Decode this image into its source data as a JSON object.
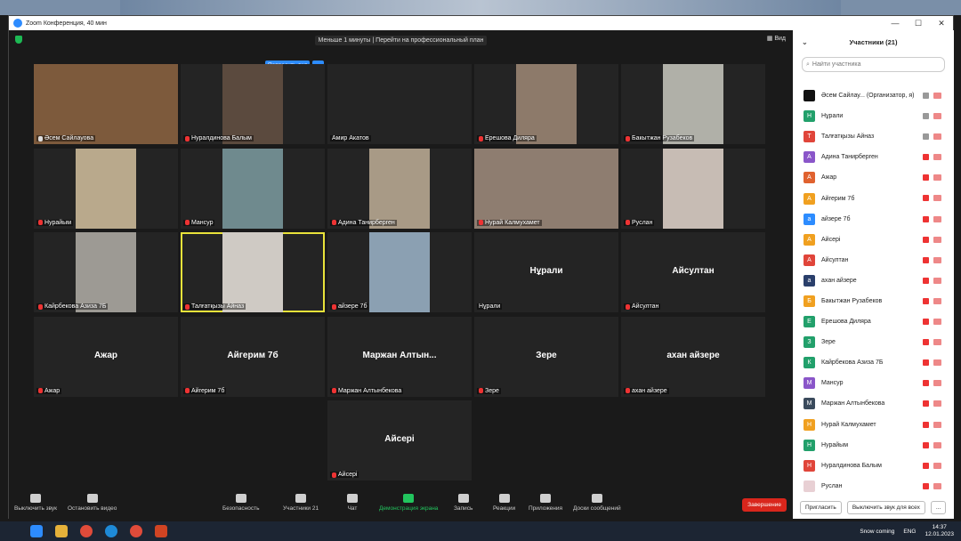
{
  "window": {
    "title": "Zoom Конференция, 40 мин",
    "controls": [
      "—",
      "☐",
      "✕"
    ]
  },
  "banner": "Меньше 1 минуты | Перейти на профессиональный план",
  "view_label": "▦ Вид",
  "ask_button": "Попросить вкл",
  "ask_more": "···",
  "tiles": [
    {
      "name": "Әсем Сайлауова",
      "mic": "on",
      "video": "#7d5a3c"
    },
    {
      "name": "Нуралдинова Балым",
      "mic": "off",
      "video": "#5b4a3e"
    },
    {
      "name": "Амир Акатов",
      "mic": "none",
      "video": ""
    },
    {
      "name": "Ерешова Диляра",
      "mic": "off",
      "video": "#8d7a6a"
    },
    {
      "name": "Бакытжан Рузабеков",
      "mic": "off",
      "video": "#b0b0a8"
    },
    {
      "name": "Нурайым",
      "mic": "off",
      "video": "#b9a98c"
    },
    {
      "name": "Мансур",
      "mic": "off",
      "video": "#6f8a8e"
    },
    {
      "name": "Адина Танирберген",
      "mic": "off",
      "video": "#a89a86"
    },
    {
      "name": "Нурай Калмухамет",
      "mic": "off",
      "video": "#8e7d70"
    },
    {
      "name": "Руслан",
      "mic": "off",
      "video": "#c7bcb4"
    },
    {
      "name": "Кайрбекова Азиза 7Б",
      "mic": "off",
      "video": "#9d9a94"
    },
    {
      "name": "Талғатқызы Айназ",
      "mic": "off",
      "video": "#cfcac4"
    },
    {
      "name": "айзере 7б",
      "mic": "off",
      "video": "#8ba0b2"
    },
    {
      "name": "Нұрали",
      "mic": "none",
      "big": "Нұрали"
    },
    {
      "name": "Айсултан",
      "mic": "off",
      "big": "Айсултан"
    },
    {
      "name": "Ажар",
      "mic": "off",
      "big": "Ажар"
    },
    {
      "name": "Айгерим 7б",
      "mic": "off",
      "big": "Айгерим 7б"
    },
    {
      "name": "Маржан Алтынбекова",
      "mic": "off",
      "big": "Маржан  Алтын..."
    },
    {
      "name": "Зере",
      "mic": "off",
      "big": "Зере"
    },
    {
      "name": "ахан айзере",
      "mic": "off",
      "big": "ахан айзере"
    },
    {
      "name": "Айсері",
      "mic": "off",
      "big": "Айсері"
    }
  ],
  "toolbar": {
    "audio": "Выключить звук",
    "video": "Остановить видео",
    "security": "Безопасность",
    "participants": "Участники",
    "participants_count": "21",
    "chat": "Чат",
    "share": "Демонстрация экрана",
    "record": "Запись",
    "reactions": "Реакции",
    "apps": "Приложения",
    "whiteboards": "Доски сообщений",
    "end": "Завершение"
  },
  "panel": {
    "title": "Участники (21)",
    "search_placeholder": "Найти участника",
    "invite": "Пригласить",
    "mute_all": "Выключить звук для всех",
    "more": "...",
    "participants": [
      {
        "initial": "",
        "name": "Әсем Сайлау... (Организатор, я)",
        "color": "#111111",
        "muted": false
      },
      {
        "initial": "Н",
        "name": "Нұрали",
        "color": "#22a06b",
        "muted": false
      },
      {
        "initial": "Т",
        "name": "Талғатқызы Айназ",
        "color": "#e0453a",
        "muted": false
      },
      {
        "initial": "А",
        "name": "Адина Танирберген",
        "color": "#8a56c9",
        "muted": true
      },
      {
        "initial": "А",
        "name": "Ажар",
        "color": "#e0622f",
        "muted": true
      },
      {
        "initial": "А",
        "name": "Айгерим 7б",
        "color": "#f0a020",
        "muted": true
      },
      {
        "initial": "а",
        "name": "айзере 7б",
        "color": "#2d8cff",
        "muted": true
      },
      {
        "initial": "А",
        "name": "Айсері",
        "color": "#f0a020",
        "muted": true
      },
      {
        "initial": "А",
        "name": "Айсултан",
        "color": "#e0453a",
        "muted": true
      },
      {
        "initial": "а",
        "name": "ахан айзере",
        "color": "#2a3f6b",
        "muted": true
      },
      {
        "initial": "Б",
        "name": "Бакытжан Рузабеков",
        "color": "#f0a020",
        "muted": true
      },
      {
        "initial": "Е",
        "name": "Ерешова Диляра",
        "color": "#22a06b",
        "muted": true
      },
      {
        "initial": "З",
        "name": "Зере",
        "color": "#22a06b",
        "muted": true
      },
      {
        "initial": "К",
        "name": "Кайрбекова Азиза 7Б",
        "color": "#22a06b",
        "muted": true
      },
      {
        "initial": "М",
        "name": "Мансур",
        "color": "#8a56c9",
        "muted": true
      },
      {
        "initial": "М",
        "name": "Маржан Алтынбекова",
        "color": "#3a4a5c",
        "muted": true
      },
      {
        "initial": "Н",
        "name": "Нурай Калмухамет",
        "color": "#f0a020",
        "muted": true
      },
      {
        "initial": "Н",
        "name": "Нурайым",
        "color": "#22a06b",
        "muted": true
      },
      {
        "initial": "Н",
        "name": "Нуралдинова Балым",
        "color": "#e0453a",
        "muted": true
      },
      {
        "initial": "",
        "name": "Руслан",
        "color": "#e8d0d4",
        "muted": true
      }
    ]
  },
  "taskbar": {
    "weather": "Snow coming",
    "lang": "ENG",
    "time": "14:37",
    "date": "12.01.2023"
  }
}
